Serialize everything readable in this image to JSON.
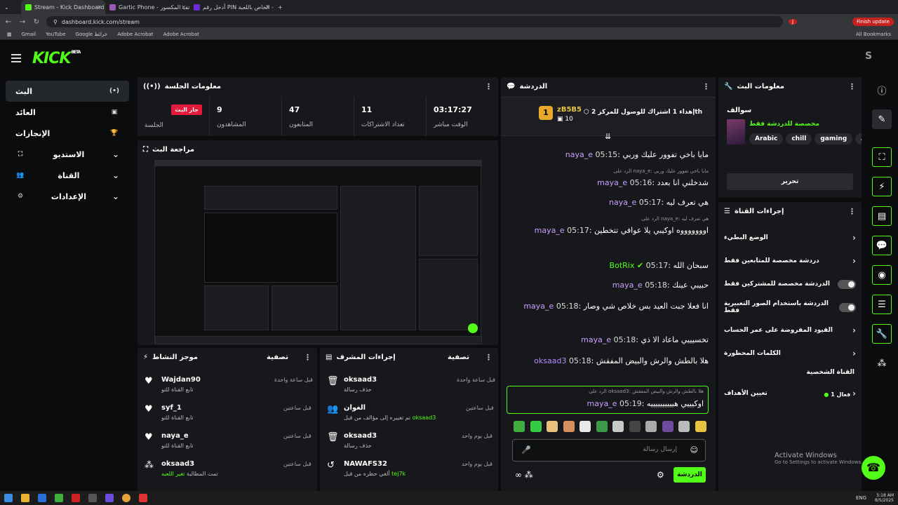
{
  "browser": {
    "tabs": [
      {
        "label": "Stream - Kick Dashboard",
        "color": "#53fc18"
      },
      {
        "label": "Gartic Phone - الهاتف المكسور",
        "color": "#9b59b6"
      },
      {
        "label": "أدخل رقم PIN الخاص باللعبة - !it",
        "color": "#6c2bd9"
      }
    ],
    "url": "dashboard.kick.com/stream",
    "finish_update": "Finish update",
    "bookmarks": [
      "Gmail",
      "YouTube",
      "Google خرائط",
      "Adobe Acrobat",
      "Adobe Acrobat"
    ],
    "all_bookmarks": "All Bookmarks"
  },
  "app": {
    "logo": "KICK",
    "logo_badge": "BETA",
    "avatar_letter": "S"
  },
  "sidebar": {
    "items": [
      {
        "label": "البث",
        "icon": "(•)"
      },
      {
        "label": "العائد",
        "icon": "▣"
      },
      {
        "label": "الإنجازات",
        "icon": "🏆"
      },
      {
        "label": "الاستديو",
        "icon": "⛶"
      },
      {
        "label": "القناة",
        "icon": "👥"
      },
      {
        "label": "الإعدادات",
        "icon": "⚙"
      }
    ]
  },
  "session": {
    "title": "معلومات الجلسة",
    "stats": [
      {
        "value": "03:17:27",
        "label": "الوقت مباشر"
      },
      {
        "value": "11",
        "label": "تعداد الاشتراكات"
      },
      {
        "value": "47",
        "label": "المتابعون"
      },
      {
        "value": "9",
        "label": "المشاهدون"
      },
      {
        "value": "جار البث",
        "label": "الجلسة"
      }
    ]
  },
  "preview": {
    "title": "مراجعة البث"
  },
  "activity": {
    "title": "موجز النشاط",
    "filter": "تصفية",
    "rows": [
      {
        "name": "Wajdan90",
        "sub": "تابع القناة للتو",
        "time": "قبل ساعة واحدة",
        "icon": "♥"
      },
      {
        "name": "syf_1",
        "sub": "تابع القناة للتو",
        "time": "قبل ساعتين",
        "icon": "♥"
      },
      {
        "name": "naya_e",
        "sub": "تابع القناة للتو",
        "time": "قبل ساعتين",
        "icon": "♥"
      },
      {
        "name": "oksaad3",
        "sub": "تمت المطالبة",
        "sub_hl": "تغير اللعبه",
        "time": "قبل ساعتين",
        "icon": "⁂"
      }
    ]
  },
  "modactions": {
    "title": "إجراءات المشرف",
    "filter": "تصفية",
    "rows": [
      {
        "name": "oksaad3",
        "sub": "حذف رسالة",
        "time": "قبل ساعة واحدة",
        "icon": "🗑"
      },
      {
        "name": "الغوان",
        "sub": "تم تغييره إلى مؤالف من قبل",
        "sub_hl": "oksaad3",
        "time": "قبل ساعتين",
        "icon": "👥"
      },
      {
        "name": "oksaad3",
        "sub": "حذف رسالة",
        "time": "قبل يوم واحد",
        "icon": "🗑"
      },
      {
        "name": "NAWAFS32",
        "sub": "ألغي حظره من قبل",
        "sub_hl": "tej7k",
        "time": "قبل يوم واحد",
        "icon": "↺"
      }
    ]
  },
  "chat": {
    "title": "الدردشة",
    "pinned_user": "zB5B5",
    "pinned_count": "10",
    "pinned_text": "إهداء 1 اشتراك للوصول للمركز 2",
    "pinned_suffix": "th",
    "messages": [
      {
        "time": "05:15",
        "user": "naya_e",
        "text": "مايا باخي تفوور عليك وربي",
        "reply": ""
      },
      {
        "time": "05:16",
        "user": "maya_e",
        "text": "شدخلني انا بعدد",
        "reply": "الرد على naya_e: مايا باخي تفوور عليك وربي"
      },
      {
        "time": "05:17",
        "user": "naya_e",
        "text": "هي تعرف ليه",
        "reply": ""
      },
      {
        "time": "05:17",
        "user": "maya_e",
        "text": "اوووووووه اوكيبي يلا عوافي تتخطين",
        "reply": "الرد على naya_e: هي تعرف ليه"
      },
      {
        "time": "05:17",
        "user": "BotRix",
        "text": "سبحان الله",
        "reply": ""
      },
      {
        "time": "05:18",
        "user": "maya_e",
        "text": "حبيبي عينك",
        "reply": ""
      },
      {
        "time": "05:18",
        "user": "maya_e",
        "text": "انا فعلا جبت العيد بس خلاص شي وصار",
        "reply": ""
      },
      {
        "time": "05:18",
        "user": "maya_e",
        "text": "تخسيييي ماعاد الا ذي",
        "reply": ""
      },
      {
        "time": "05:18",
        "user": "oksaad3",
        "text": "هلا بالطش والرش والبيض المفقش",
        "reply": ""
      },
      {
        "time": "05:19",
        "user": "maya_e",
        "text": "اوكيييي هييييييييييه",
        "reply": "الرد على oksaad3: هلا بالطش والرش والبيض المفقش"
      }
    ],
    "input_placeholder": "إرسال رسالة",
    "send_label": "الدردشة",
    "emote_colors": [
      "#3fae3f",
      "#33cc44",
      "#e7c079",
      "#d68f5e",
      "#e8e8e8",
      "#3a9a4a",
      "#c8c8c8",
      "#444",
      "#aaa",
      "#6b4b9a",
      "#bbb",
      "#e8c341"
    ]
  },
  "streaminfo": {
    "title": "معلومات البث",
    "category": "سوالف",
    "category_note": "مخصصة للدردشة فقط",
    "tags": [
      "Arabic",
      "chill",
      "gaming",
      "AR"
    ],
    "edit_label": "تحرير"
  },
  "channel": {
    "title": "إجراءات القناة",
    "rows": [
      {
        "label": "الوضع البطيء",
        "kind": "chevron"
      },
      {
        "label": "دردشة مخصصة للمتابعين فقط",
        "kind": "chevron"
      },
      {
        "label": "الدردشة مخصصة للمشتركين فقط",
        "kind": "toggle"
      },
      {
        "label": "الدردشة باستخدام الصور التعبيرية فقط",
        "kind": "toggle"
      },
      {
        "label": "القيود المفروضة على عمر الحساب",
        "kind": "chevron"
      },
      {
        "label": "الكلمات المحظورة",
        "kind": "chevron"
      }
    ],
    "section": "القناة الشخصية",
    "goal_label": "تعيين الأهداف",
    "goal_value": "فعال 1"
  },
  "watermark": {
    "line1": "Activate Windows",
    "line2": "Go to Settings to activate Windows."
  },
  "taskbar": {
    "time": "5:18 AM",
    "date": "8/5/2025",
    "lang": "ENG"
  }
}
